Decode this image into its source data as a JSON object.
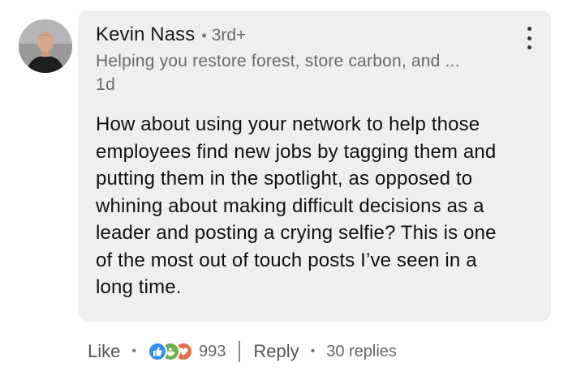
{
  "author": {
    "name": "Kevin Nass",
    "degree": "3rd+",
    "headline": "Helping you restore forest, store carbon, and ...",
    "time_ago": "1d"
  },
  "comment": {
    "text": "How about using your network to help those\nemployees find new jobs by tagging them and\nputting them in the spotlight, as opposed to\nwhining about making difficult decisions as a\nleader and posting a crying selfie? This is one\nof the most out of touch posts I’ve seen in a\nlong time."
  },
  "actions": {
    "like_label": "Like",
    "reaction_count": "993",
    "reply_label": "Reply",
    "replies_label": "30 replies"
  },
  "icons": {
    "avatar": "avatar-photo",
    "menu": "more-options-icon",
    "reactions": [
      "like-reaction-icon",
      "support-reaction-icon",
      "love-reaction-icon"
    ]
  },
  "colors": {
    "bubble_bg": "#efefef",
    "like_blue": "#378fe9",
    "support_green": "#6dae4f",
    "love_red": "#df704d",
    "secondary_text": "#6a6a6a"
  }
}
